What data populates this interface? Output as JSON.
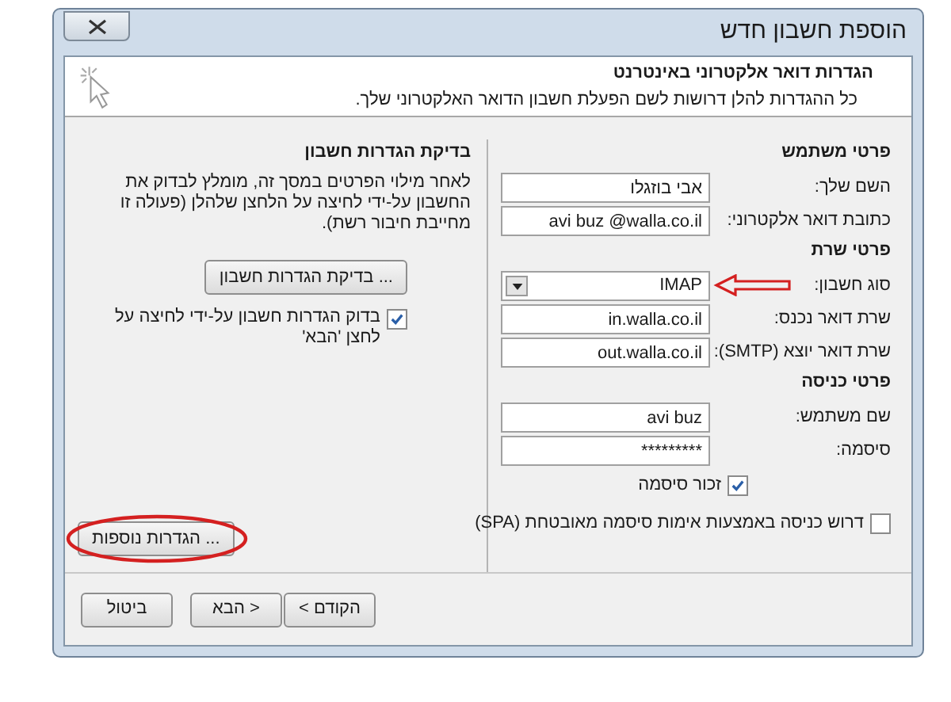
{
  "window": {
    "title": "הוספת חשבון חדש"
  },
  "header": {
    "title": "הגדרות דואר אלקטרוני באינטרנט",
    "subtitle": "כל ההגדרות להלן דרושות לשם הפעלת חשבון הדואר האלקטרוני שלך."
  },
  "sections": [
    {
      "heading": "פרטי משתמש",
      "fields": [
        {
          "kind": "text",
          "label": "השם שלך:",
          "value": "אבי בוזגלו"
        },
        {
          "kind": "text",
          "label": "כתובת דואר אלקטרוני:",
          "value": "avi buz @walla.co.il"
        }
      ]
    },
    {
      "heading": "פרטי שרת",
      "fields": [
        {
          "kind": "select",
          "label": "סוג חשבון:",
          "value": "IMAP"
        },
        {
          "kind": "text",
          "label": "שרת דואר נכנס:",
          "value": "in.walla.co.il"
        },
        {
          "kind": "text",
          "label": "שרת דואר יוצא (SMTP):",
          "value": "out.walla.co.il"
        }
      ]
    },
    {
      "heading": "פרטי כניסה",
      "fields": [
        {
          "kind": "text",
          "label": "שם משתמש:",
          "value": "avi buz"
        },
        {
          "kind": "text",
          "label": "סיסמה:",
          "value": "*********"
        }
      ]
    }
  ],
  "remember_password": {
    "label": "זכור סיסמה",
    "checked": true
  },
  "require_spa": {
    "label": "דרוש כניסה באמצעות אימות סיסמה מאובטחת (SPA)",
    "checked": false
  },
  "test": {
    "heading": "בדיקת הגדרות חשבון",
    "description": "לאחר מילוי הפרטים במסך זה, מומלץ לבדוק את החשבון על-ידי לחיצה על הלחצן שלהלן (פעולה זו מחייבת חיבור רשת).",
    "button": "בדיקת הגדרות חשבון ...",
    "checkbox": {
      "label": "בדוק הגדרות חשבון על-ידי לחיצה על לחצן 'הבא'",
      "checked": true
    }
  },
  "more_settings_button": "הגדרות נוספות ...",
  "footer": {
    "buttons": [
      "< הקודם",
      "הבא >",
      "ביטול"
    ]
  }
}
